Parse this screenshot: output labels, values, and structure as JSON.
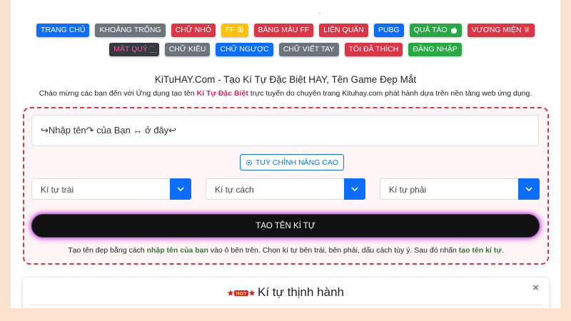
{
  "nav": {
    "row1": [
      {
        "label": "TRANG CHỦ",
        "color": "#0d6efd"
      },
      {
        "label": "KHOẢNG TRỐNG",
        "color": "#6c757d"
      },
      {
        "label": "CHỮ NHỎ",
        "color": "#dc3545"
      },
      {
        "label": "FF ꕥ",
        "color": "#ffc107"
      },
      {
        "label": "BẢNG MÀU FF",
        "color": "#dc3545"
      },
      {
        "label": "LIÊN QUÂN",
        "color": "#dc3545"
      },
      {
        "label": "PUBG",
        "color": "#0d6efd"
      },
      {
        "label": "QUẢ TÁO",
        "color": "#28a745",
        "icon": "apple-icon"
      },
      {
        "label": "VƯƠNG MIỆN ♕",
        "color": "#dc3545"
      }
    ],
    "row2": [
      {
        "label": "MẶT QUỶ ˋ͟ˊ",
        "color": "#343a40"
      },
      {
        "label": "CHỮ KIỂU",
        "color": "#6c757d"
      },
      {
        "label": "CHỮ NGƯỢC",
        "color": "#0d6efd"
      },
      {
        "label": "CHỮ VIẾT TAY",
        "color": "#6c757d"
      },
      {
        "label": "TÔI ĐÃ THÍCH",
        "color": "#dc3545"
      },
      {
        "label": "ĐĂNG NHẬP",
        "color": "#28a745"
      }
    ]
  },
  "header": {
    "title": "KiTuHAY.Com - Tạo Kí Tự Đặc Biệt HAY, Tên Game Đẹp Mắt",
    "subtitle_pre": "Chào mừng các bạn đến với Ứng dụng tạo tên ",
    "subtitle_hl": "Kí Tự Đặc Biệt",
    "subtitle_post": " trực tuyến do chuyên trang Kituhay.com phát hành dựa trên nền tảng web ứng dụng."
  },
  "form": {
    "input_value": "↪Nhập tên↷ của Bạn ↔ ở đây↩",
    "advanced_label": "TUỲ CHỈNH NÂNG CAO",
    "select_left": "Kí tự trái",
    "select_middle": "Kí tự cách",
    "select_right": "Kí tự phải",
    "create_label": "TẠO TÊN KÍ TỰ",
    "guide_1": "Tạo tên đẹp bằng cách ",
    "guide_hl1": "nhập tên của bạn",
    "guide_2": " vào ô bên trên. Chọn kí tự bên trái, bên phải, dấu cách tùy ý. Sau đó nhấn ",
    "guide_hl2": "tạo tên kí tự",
    "guide_3": "."
  },
  "trending": {
    "title": "Kí tự thịnh hành",
    "badge": "HOT",
    "close": "×"
  }
}
